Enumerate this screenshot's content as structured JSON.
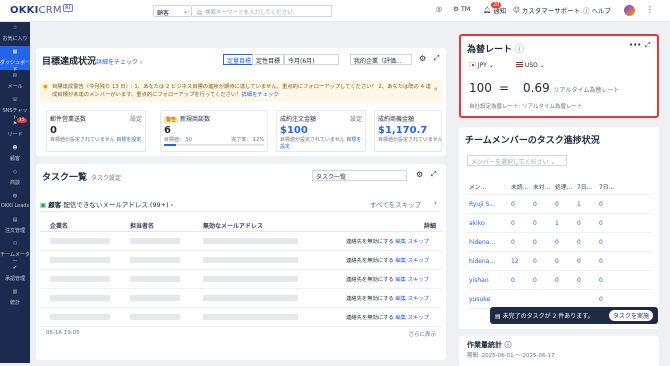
{
  "topbar": {
    "logo_bold": "OKKI",
    "logo_rest": "CRM",
    "logo_ai": "AI",
    "scope": "顧客",
    "search_placeholder": "検索キーワードを入力してください",
    "user": "TM",
    "notice": "通知",
    "notice_count": "20",
    "support": "カスタマーサポート",
    "help": "ヘルプ"
  },
  "sidebar": [
    {
      "label": "お気に入り"
    },
    {
      "label": "ダッシュボード"
    },
    {
      "label": "メール"
    },
    {
      "label": "SNSチャット"
    },
    {
      "label": "リード",
      "badge": "15"
    },
    {
      "label": "顧客"
    },
    {
      "label": "商談"
    },
    {
      "label": "OKKI Leads"
    },
    {
      "label": "注文管理"
    },
    {
      "label": "チームメーター"
    },
    {
      "label": "承認管理"
    },
    {
      "label": "統計"
    }
  ],
  "goals": {
    "title": "目標達成状況",
    "detail_link": "詳細をチェック",
    "tab_fixed": "定量目標",
    "tab_qual": "定性目標",
    "period": "今月(6月)",
    "company": "我的企業（評価...",
    "alert": "目標達成警告（今月残り 13 日）: 1、あなたは 2 ビジネス目標の進捗が期待に達していません。重点的にフォローアップしてください！ 2、あなたは既の 4 達成目標が未達のメンバーがいます。重点的にフォローアップを行ってください！",
    "alert_link": "詳細をチェック",
    "metrics": [
      {
        "title": "郵件営業送数",
        "link": "設定",
        "value": "0",
        "sub": "目標値が設定されていません",
        "sublink": "目標を設定"
      },
      {
        "title": "新規商談数",
        "tag": "警告",
        "link": "",
        "value": "6",
        "sub": "目標値： 50",
        "pct": "完了率： 12%",
        "progress": 0.12
      },
      {
        "title": "成約注文金額",
        "link": "設定",
        "value": "$100",
        "sub": "目標値が設定されていません",
        "sublink": "目標を設定"
      },
      {
        "title": "成約商機金額",
        "link": "",
        "value": "$1,170.7",
        "sub": "目標値が設定されていません",
        "sublink": ""
      }
    ]
  },
  "tasks": {
    "title": "タスク一覧",
    "setting": "タスク設定",
    "select": "タスク一覧",
    "section_title": "顧客",
    "section_desc": "配信できないメールアドレス (99+)",
    "skip_all": "すべてをスキップ",
    "columns": [
      "企業名",
      "担当者名",
      "無効なメールアドレス",
      "詳細"
    ],
    "row_action": "連絡先を無効にする",
    "edit": "編集",
    "skip": "スキップ",
    "rows": 5,
    "date": "05-16 19:05",
    "more": "さらに表示"
  },
  "exchange": {
    "title": "為替レート",
    "from": "JPY",
    "to": "USD",
    "amount": "100",
    "eq": "=",
    "result": "0.69",
    "realtime": "リアルタイム為替レート",
    "custom": "自社設定為替レート: リアルタイム為替レート"
  },
  "team": {
    "title": "チームメンバーのタスク進捗状況",
    "select_placeholder": "メンバーを選択してください",
    "columns": [
      "メン...",
      "未読...",
      "未対...",
      "処理...",
      "7日...",
      "7日..."
    ],
    "rows": [
      {
        "name": "Ryuji S...",
        "v": [
          "0",
          "0",
          "0",
          "1",
          "0"
        ]
      },
      {
        "name": "akiko",
        "v": [
          "0",
          "0",
          "1",
          "0",
          "0"
        ]
      },
      {
        "name": "hidena...",
        "v": [
          "0",
          "0",
          "0",
          "0",
          "0"
        ]
      },
      {
        "name": "hidena...",
        "v": [
          "12",
          "0",
          "0",
          "0",
          "0"
        ]
      },
      {
        "name": "yishan",
        "v": [
          "0",
          "0",
          "0",
          "0",
          "0"
        ]
      },
      {
        "name": "yusuke",
        "v": [
          "",
          "",
          "",
          "",
          "0"
        ]
      }
    ]
  },
  "toast": {
    "text": "未完了のタスクが 2 件あります。",
    "button": "タスクを実施"
  },
  "stats": {
    "title": "作業量統計",
    "range": "期間: 2025-06-01 ～ 2025-06-17"
  }
}
